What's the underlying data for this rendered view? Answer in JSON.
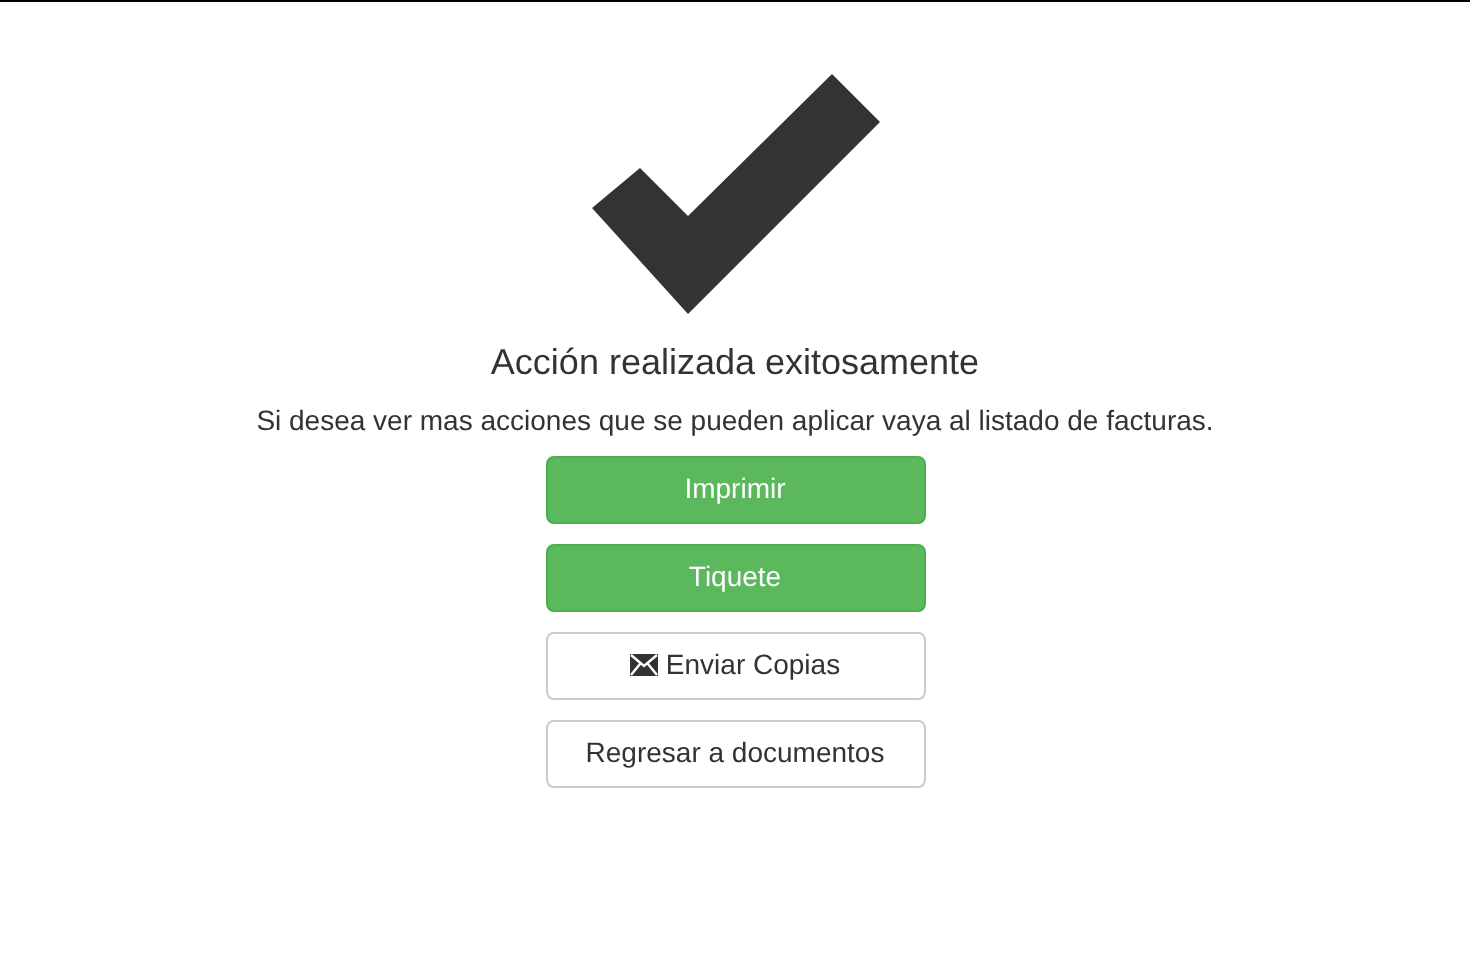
{
  "message": {
    "title": "Acción realizada exitosamente",
    "text": "Si desea ver mas acciones que se pueden aplicar vaya al listado de facturas."
  },
  "buttons": [
    {
      "label": "Imprimir",
      "kind": "success",
      "icon": false
    },
    {
      "label": "Tiquete",
      "kind": "success",
      "icon": false
    },
    {
      "label": "Enviar Copias",
      "kind": "default",
      "icon": true
    },
    {
      "label": "Regresar a documentos",
      "kind": "default",
      "icon": false
    }
  ]
}
